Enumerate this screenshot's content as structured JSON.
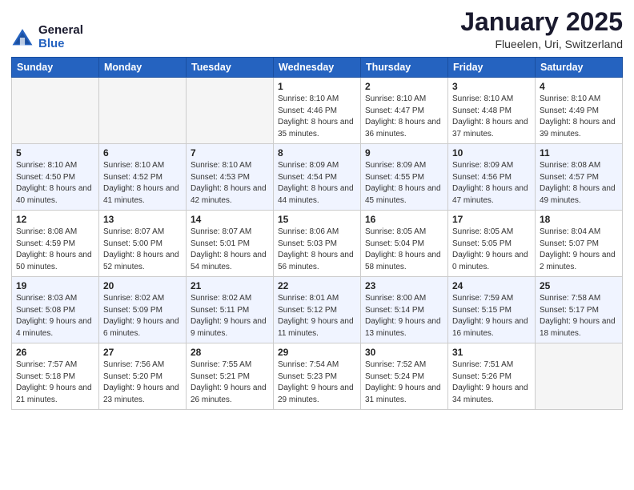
{
  "logo": {
    "general": "General",
    "blue": "Blue"
  },
  "title": "January 2025",
  "subtitle": "Flueelen, Uri, Switzerland",
  "days_of_week": [
    "Sunday",
    "Monday",
    "Tuesday",
    "Wednesday",
    "Thursday",
    "Friday",
    "Saturday"
  ],
  "weeks": [
    [
      {
        "day": "",
        "info": ""
      },
      {
        "day": "",
        "info": ""
      },
      {
        "day": "",
        "info": ""
      },
      {
        "day": "1",
        "info": "Sunrise: 8:10 AM\nSunset: 4:46 PM\nDaylight: 8 hours and 35 minutes."
      },
      {
        "day": "2",
        "info": "Sunrise: 8:10 AM\nSunset: 4:47 PM\nDaylight: 8 hours and 36 minutes."
      },
      {
        "day": "3",
        "info": "Sunrise: 8:10 AM\nSunset: 4:48 PM\nDaylight: 8 hours and 37 minutes."
      },
      {
        "day": "4",
        "info": "Sunrise: 8:10 AM\nSunset: 4:49 PM\nDaylight: 8 hours and 39 minutes."
      }
    ],
    [
      {
        "day": "5",
        "info": "Sunrise: 8:10 AM\nSunset: 4:50 PM\nDaylight: 8 hours and 40 minutes."
      },
      {
        "day": "6",
        "info": "Sunrise: 8:10 AM\nSunset: 4:52 PM\nDaylight: 8 hours and 41 minutes."
      },
      {
        "day": "7",
        "info": "Sunrise: 8:10 AM\nSunset: 4:53 PM\nDaylight: 8 hours and 42 minutes."
      },
      {
        "day": "8",
        "info": "Sunrise: 8:09 AM\nSunset: 4:54 PM\nDaylight: 8 hours and 44 minutes."
      },
      {
        "day": "9",
        "info": "Sunrise: 8:09 AM\nSunset: 4:55 PM\nDaylight: 8 hours and 45 minutes."
      },
      {
        "day": "10",
        "info": "Sunrise: 8:09 AM\nSunset: 4:56 PM\nDaylight: 8 hours and 47 minutes."
      },
      {
        "day": "11",
        "info": "Sunrise: 8:08 AM\nSunset: 4:57 PM\nDaylight: 8 hours and 49 minutes."
      }
    ],
    [
      {
        "day": "12",
        "info": "Sunrise: 8:08 AM\nSunset: 4:59 PM\nDaylight: 8 hours and 50 minutes."
      },
      {
        "day": "13",
        "info": "Sunrise: 8:07 AM\nSunset: 5:00 PM\nDaylight: 8 hours and 52 minutes."
      },
      {
        "day": "14",
        "info": "Sunrise: 8:07 AM\nSunset: 5:01 PM\nDaylight: 8 hours and 54 minutes."
      },
      {
        "day": "15",
        "info": "Sunrise: 8:06 AM\nSunset: 5:03 PM\nDaylight: 8 hours and 56 minutes."
      },
      {
        "day": "16",
        "info": "Sunrise: 8:05 AM\nSunset: 5:04 PM\nDaylight: 8 hours and 58 minutes."
      },
      {
        "day": "17",
        "info": "Sunrise: 8:05 AM\nSunset: 5:05 PM\nDaylight: 9 hours and 0 minutes."
      },
      {
        "day": "18",
        "info": "Sunrise: 8:04 AM\nSunset: 5:07 PM\nDaylight: 9 hours and 2 minutes."
      }
    ],
    [
      {
        "day": "19",
        "info": "Sunrise: 8:03 AM\nSunset: 5:08 PM\nDaylight: 9 hours and 4 minutes."
      },
      {
        "day": "20",
        "info": "Sunrise: 8:02 AM\nSunset: 5:09 PM\nDaylight: 9 hours and 6 minutes."
      },
      {
        "day": "21",
        "info": "Sunrise: 8:02 AM\nSunset: 5:11 PM\nDaylight: 9 hours and 9 minutes."
      },
      {
        "day": "22",
        "info": "Sunrise: 8:01 AM\nSunset: 5:12 PM\nDaylight: 9 hours and 11 minutes."
      },
      {
        "day": "23",
        "info": "Sunrise: 8:00 AM\nSunset: 5:14 PM\nDaylight: 9 hours and 13 minutes."
      },
      {
        "day": "24",
        "info": "Sunrise: 7:59 AM\nSunset: 5:15 PM\nDaylight: 9 hours and 16 minutes."
      },
      {
        "day": "25",
        "info": "Sunrise: 7:58 AM\nSunset: 5:17 PM\nDaylight: 9 hours and 18 minutes."
      }
    ],
    [
      {
        "day": "26",
        "info": "Sunrise: 7:57 AM\nSunset: 5:18 PM\nDaylight: 9 hours and 21 minutes."
      },
      {
        "day": "27",
        "info": "Sunrise: 7:56 AM\nSunset: 5:20 PM\nDaylight: 9 hours and 23 minutes."
      },
      {
        "day": "28",
        "info": "Sunrise: 7:55 AM\nSunset: 5:21 PM\nDaylight: 9 hours and 26 minutes."
      },
      {
        "day": "29",
        "info": "Sunrise: 7:54 AM\nSunset: 5:23 PM\nDaylight: 9 hours and 29 minutes."
      },
      {
        "day": "30",
        "info": "Sunrise: 7:52 AM\nSunset: 5:24 PM\nDaylight: 9 hours and 31 minutes."
      },
      {
        "day": "31",
        "info": "Sunrise: 7:51 AM\nSunset: 5:26 PM\nDaylight: 9 hours and 34 minutes."
      },
      {
        "day": "",
        "info": ""
      }
    ]
  ]
}
